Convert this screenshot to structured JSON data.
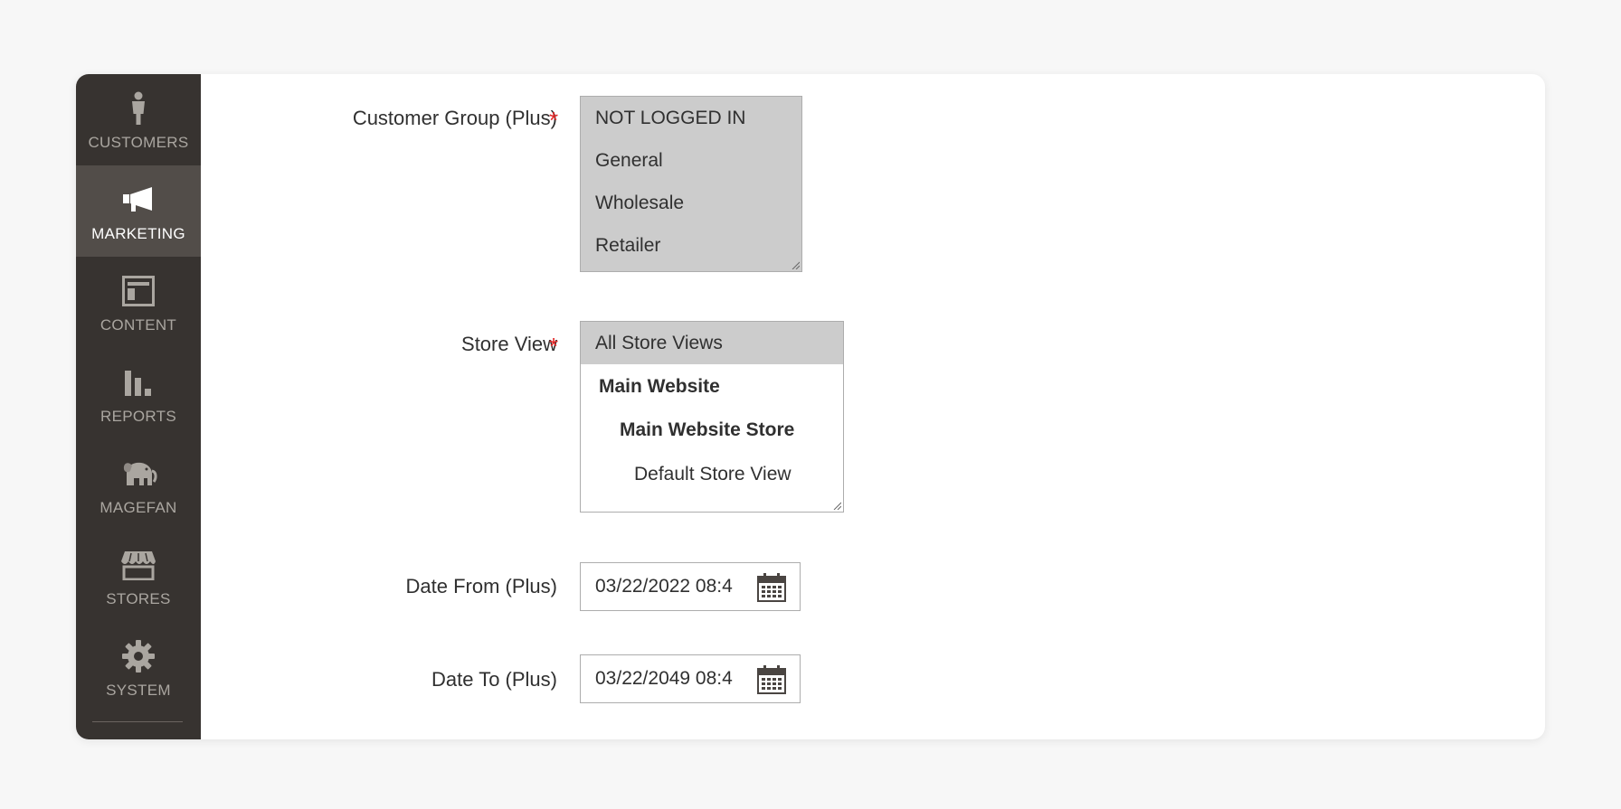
{
  "sidebar": {
    "items": [
      {
        "label": "CUSTOMERS",
        "icon": "person-icon"
      },
      {
        "label": "MARKETING",
        "icon": "megaphone-icon",
        "active": true
      },
      {
        "label": "CONTENT",
        "icon": "layout-icon"
      },
      {
        "label": "REPORTS",
        "icon": "bar-chart-icon"
      },
      {
        "label": "MAGEFAN",
        "icon": "elephant-icon"
      },
      {
        "label": "STORES",
        "icon": "storefront-icon"
      },
      {
        "label": "SYSTEM",
        "icon": "gear-icon"
      }
    ]
  },
  "form": {
    "required_mark": "*",
    "customer_group": {
      "label": "Customer Group (Plus)",
      "options": [
        "NOT LOGGED IN",
        "General",
        "Wholesale",
        "Retailer"
      ],
      "all_selected": true
    },
    "store_view": {
      "label": "Store View",
      "options": [
        {
          "text": "All Store Views",
          "selected": true
        },
        {
          "text": "Main Website",
          "bold": true
        },
        {
          "text": "Main Website Store",
          "bold": true
        },
        {
          "text": "Default Store View"
        }
      ]
    },
    "date_from": {
      "label": "Date From (Plus)",
      "value": "03/22/2022 08:4"
    },
    "date_to": {
      "label": "Date To (Plus)",
      "value": "03/22/2049 08:4"
    }
  },
  "colors": {
    "sidebar_bg": "#373330",
    "sidebar_active_bg": "#524d49",
    "required_star": "#e22626",
    "selected_option_bg": "#cccccc"
  }
}
